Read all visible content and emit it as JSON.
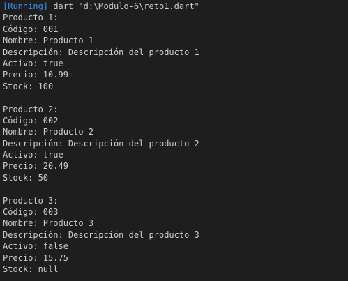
{
  "header": {
    "tag": "[Running]",
    "command": " dart \"d:\\Modulo-6\\reto1.dart\""
  },
  "colors": {
    "background": "#1e1e1e",
    "text": "#cccccc",
    "running_tag": "#3b8eea"
  },
  "products": [
    {
      "title": "Producto 1:",
      "codigo": "Código: 001",
      "nombre": "Nombre: Producto 1",
      "descripcion": "Descripción: Descripción del producto 1",
      "activo": "Activo: true",
      "precio": "Precio: 10.99",
      "stock": "Stock: 100"
    },
    {
      "title": "Producto 2:",
      "codigo": "Código: 002",
      "nombre": "Nombre: Producto 2",
      "descripcion": "Descripción: Descripción del producto 2",
      "activo": "Activo: true",
      "precio": "Precio: 20.49",
      "stock": "Stock: 50"
    },
    {
      "title": "Producto 3:",
      "codigo": "Código: 003",
      "nombre": "Nombre: Producto 3",
      "descripcion": "Descripción: Descripción del producto 3",
      "activo": "Activo: false",
      "precio": "Precio: 15.75",
      "stock": "Stock: null"
    }
  ]
}
